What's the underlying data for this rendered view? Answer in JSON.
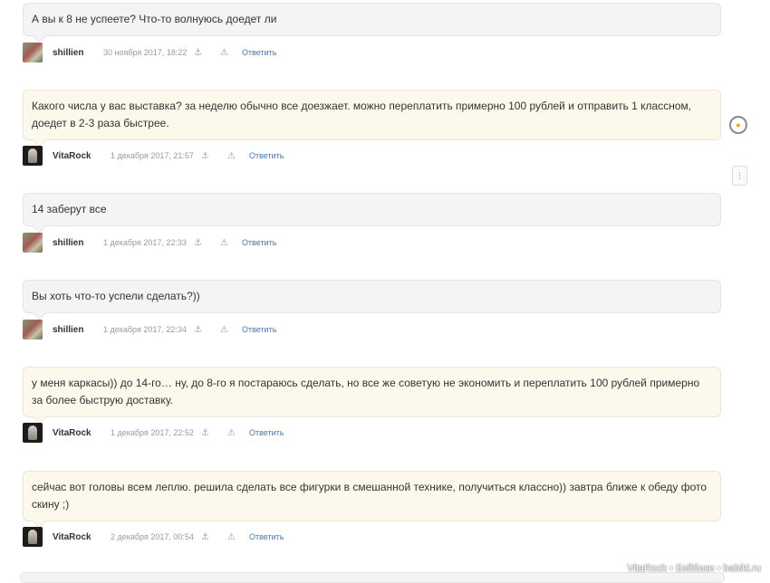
{
  "comments": [
    {
      "text": "А вы к 8 не успеете? Что-то волнуюсь доедет ли",
      "author": "shillien",
      "date": "30 ноября 2017, 18:22",
      "reply": "Ответить",
      "avatar": "shillien-avatar"
    },
    {
      "text": "Какого числа у вас выставка? за неделю обычно все доезжает. можно переплатить примерно 100 рублей и отправить 1 классном, доедет в 2-3 раза быстрее.",
      "author": "VitaRock",
      "date": "1 декабря 2017, 21:57",
      "reply": "Ответить",
      "avatar": "vitarock-avatar"
    },
    {
      "text": "14 заберут все",
      "author": "shillien",
      "date": "1 декабря 2017, 22:33",
      "reply": "Ответить",
      "avatar": "shillien-avatar"
    },
    {
      "text": "Вы хоть что-то успели сделать?))",
      "author": "shillien",
      "date": "1 декабря 2017, 22:34",
      "reply": "Ответить",
      "avatar": "shillien-avatar"
    },
    {
      "text": "у меня каркасы)) до 14-го… ну, до 8-го я постараюсь сделать, но все же советую не экономить и переплатить 100 рублей примерно за более быструю доставку.",
      "author": "VitaRock",
      "date": "1 декабря 2017, 22:52",
      "reply": "Ответить",
      "avatar": "vitarock-avatar"
    },
    {
      "text": "сейчас вот головы всем леплю. решила сделать все фигурки в смешанной технике, получиться классно)) завтра ближе к обеду фото скину ;)",
      "author": "VitaRock",
      "date": "2 декабря 2017, 00:54",
      "reply": "Ответить",
      "avatar": "vitarock-avatar"
    }
  ],
  "icons": {
    "anchor": "anchor-icon",
    "report": "warning-icon",
    "refresh": "refresh-icon",
    "scroll": "scroll-handle-icon"
  },
  "watermark": "VitaRock • Бэйбики • babiki.ru"
}
